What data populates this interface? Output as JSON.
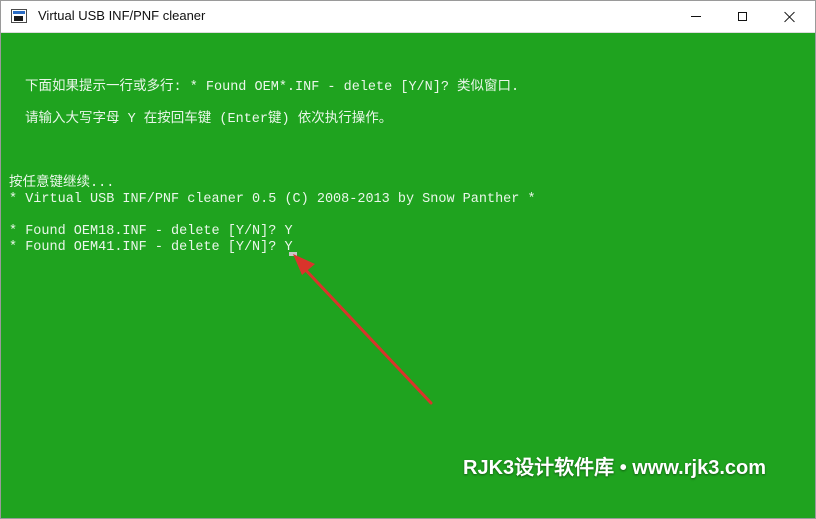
{
  "window": {
    "title": "Virtual USB INF/PNF cleaner",
    "icon": "console-window-icon",
    "controls": [
      "minimize-icon",
      "maximize-icon",
      "close-icon"
    ],
    "background_color": "#1fa31f",
    "text_color": "#eaf7ea"
  },
  "console": {
    "lines": [
      "下面如果提示一行或多行: * Found OEM*.INF - delete [Y/N]? 类似窗口.",
      "请输入大写字母 Y 在按回车键 (Enter键) 依次执行操作。",
      "按任意键继续...",
      "* Virtual USB INF/PNF cleaner 0.5 (C) 2008-2013 by Snow Panther *",
      "* Found OEM18.INF - delete [Y/N]? Y",
      "* Found OEM41.INF - delete [Y/N]? Y"
    ]
  },
  "annotation": {
    "arrow_color": "#d9342b"
  },
  "watermark": {
    "text": "RJK3设计软件库 • www.rjk3.com"
  }
}
